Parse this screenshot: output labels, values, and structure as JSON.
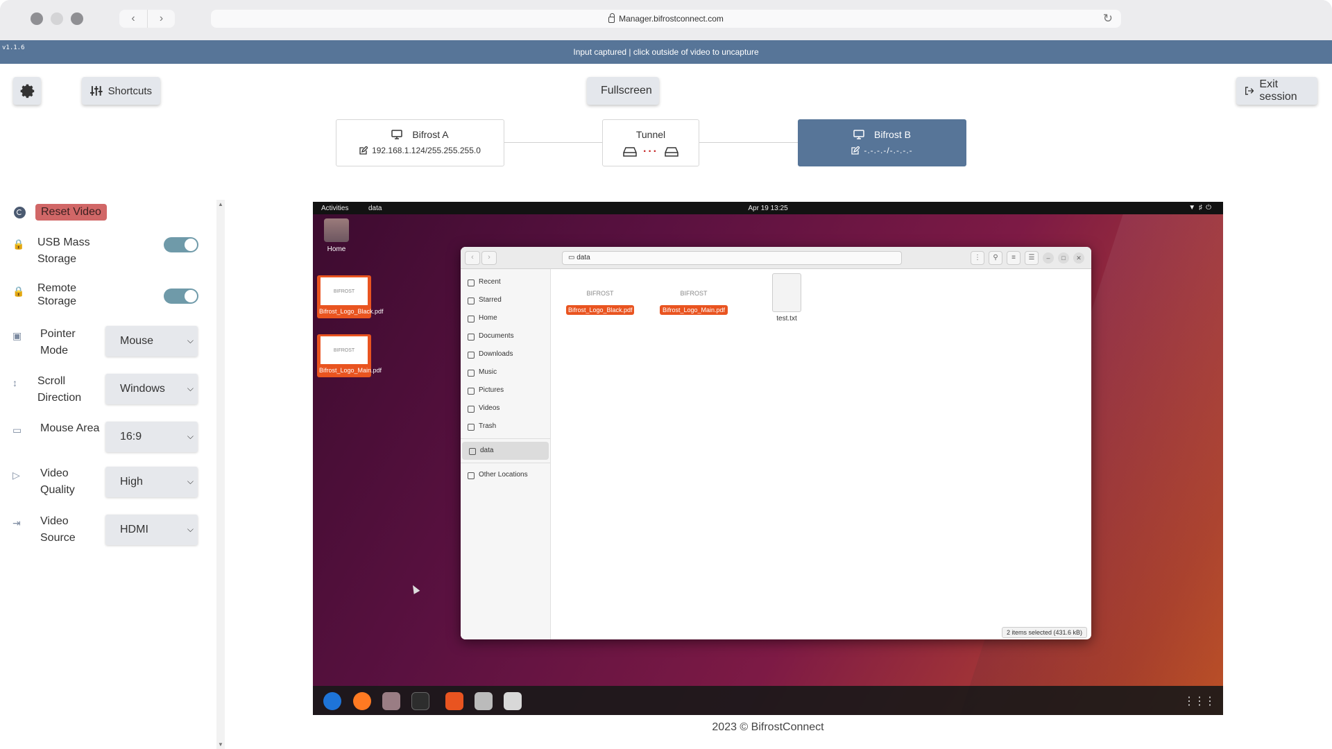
{
  "browser": {
    "url": "Manager.bifrostconnect.com"
  },
  "status": {
    "version": "v1.1.6",
    "message": "Input captured | click outside of video to uncapture"
  },
  "toolbar": {
    "shortcuts_label": "Shortcuts",
    "fullscreen_label": "Fullscreen",
    "exit_label": "Exit session"
  },
  "topology": {
    "node_a": {
      "title": "Bifrost A",
      "ip": "192.168.1.124/255.255.255.0"
    },
    "tunnel": {
      "title": "Tunnel"
    },
    "node_b": {
      "title": "Bifrost B",
      "ip": "-.-.-.-/-.-.-.-"
    }
  },
  "sidebar": {
    "reset_video_label": "Reset Video",
    "usb_storage": {
      "label": "USB Mass Storage",
      "enabled": true
    },
    "remote_storage": {
      "label": "Remote Storage",
      "enabled": true
    },
    "pointer_mode": {
      "label": "Pointer Mode",
      "value": "Mouse"
    },
    "scroll_direction": {
      "label": "Scroll Direction",
      "value": "Windows"
    },
    "mouse_area": {
      "label": "Mouse Area",
      "value": "16:9"
    },
    "video_quality": {
      "label": "Video Quality",
      "value": "High"
    },
    "video_source": {
      "label": "Video Source",
      "value": "HDMI"
    }
  },
  "remote": {
    "topbar": {
      "activities": "Activities",
      "app": "data",
      "clock": "Apr 19  13:25"
    },
    "desktop": {
      "home_label": "Home",
      "files": [
        "Bifrost_Logo_Black.pdf",
        "Bifrost_Logo_Main.pdf"
      ]
    },
    "file_manager": {
      "path": "data",
      "places": [
        "Recent",
        "Starred",
        "Home",
        "Documents",
        "Downloads",
        "Music",
        "Pictures",
        "Videos",
        "Trash"
      ],
      "mount": "data",
      "other": "Other Locations",
      "files": [
        {
          "name": "Bifrost_Logo_Black.pdf",
          "selected": true
        },
        {
          "name": "Bifrost_Logo_Main.pdf",
          "selected": true
        },
        {
          "name": "test.txt",
          "selected": false
        }
      ],
      "logo_text": "BIFROST",
      "status": "2 items selected (431.6 kB)"
    }
  },
  "footer": {
    "text": "2023 © BifrostConnect"
  },
  "colors": {
    "brand": "#577598",
    "reset": "#d16767",
    "ubuntu_orange": "#e95420",
    "toggle_on": "#6f9aa9"
  }
}
